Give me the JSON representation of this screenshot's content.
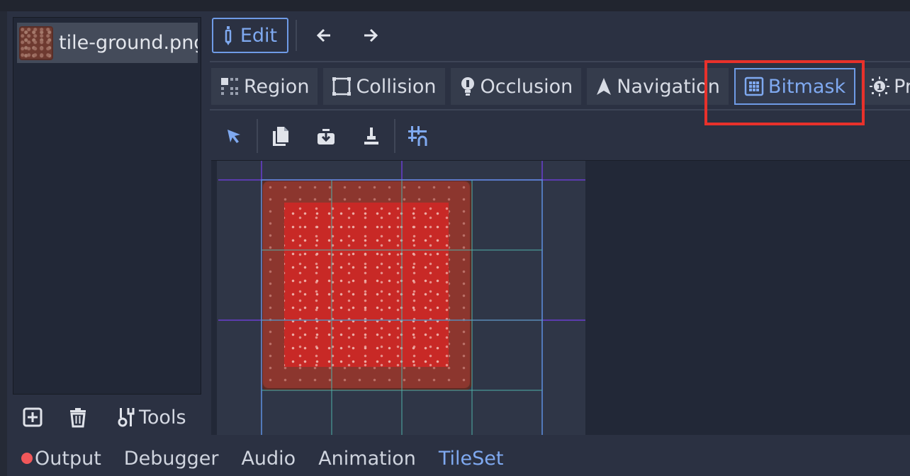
{
  "file_list": {
    "items": [
      {
        "name": "tile-ground.png"
      }
    ]
  },
  "file_actions": {
    "tools_label": "Tools"
  },
  "toolbar": {
    "edit_label": "Edit"
  },
  "mode_tabs": [
    {
      "label": "Region",
      "icon": "region-icon"
    },
    {
      "label": "Collision",
      "icon": "collision-icon"
    },
    {
      "label": "Occlusion",
      "icon": "occlusion-icon"
    },
    {
      "label": "Navigation",
      "icon": "navigation-icon"
    },
    {
      "label": "Bitmask",
      "icon": "bitmask-icon",
      "active": true
    },
    {
      "label": "Priority",
      "icon": "priority-icon"
    }
  ],
  "bottom_tabs": [
    {
      "label": "Output",
      "has_alert": true
    },
    {
      "label": "Debugger"
    },
    {
      "label": "Audio"
    },
    {
      "label": "Animation"
    },
    {
      "label": "TileSet",
      "active": true
    }
  ],
  "colors": {
    "accent": "#7fa9f0",
    "highlight_box": "#e8312b",
    "background": "#2b3142",
    "tile_overlay": "#c42a26"
  }
}
